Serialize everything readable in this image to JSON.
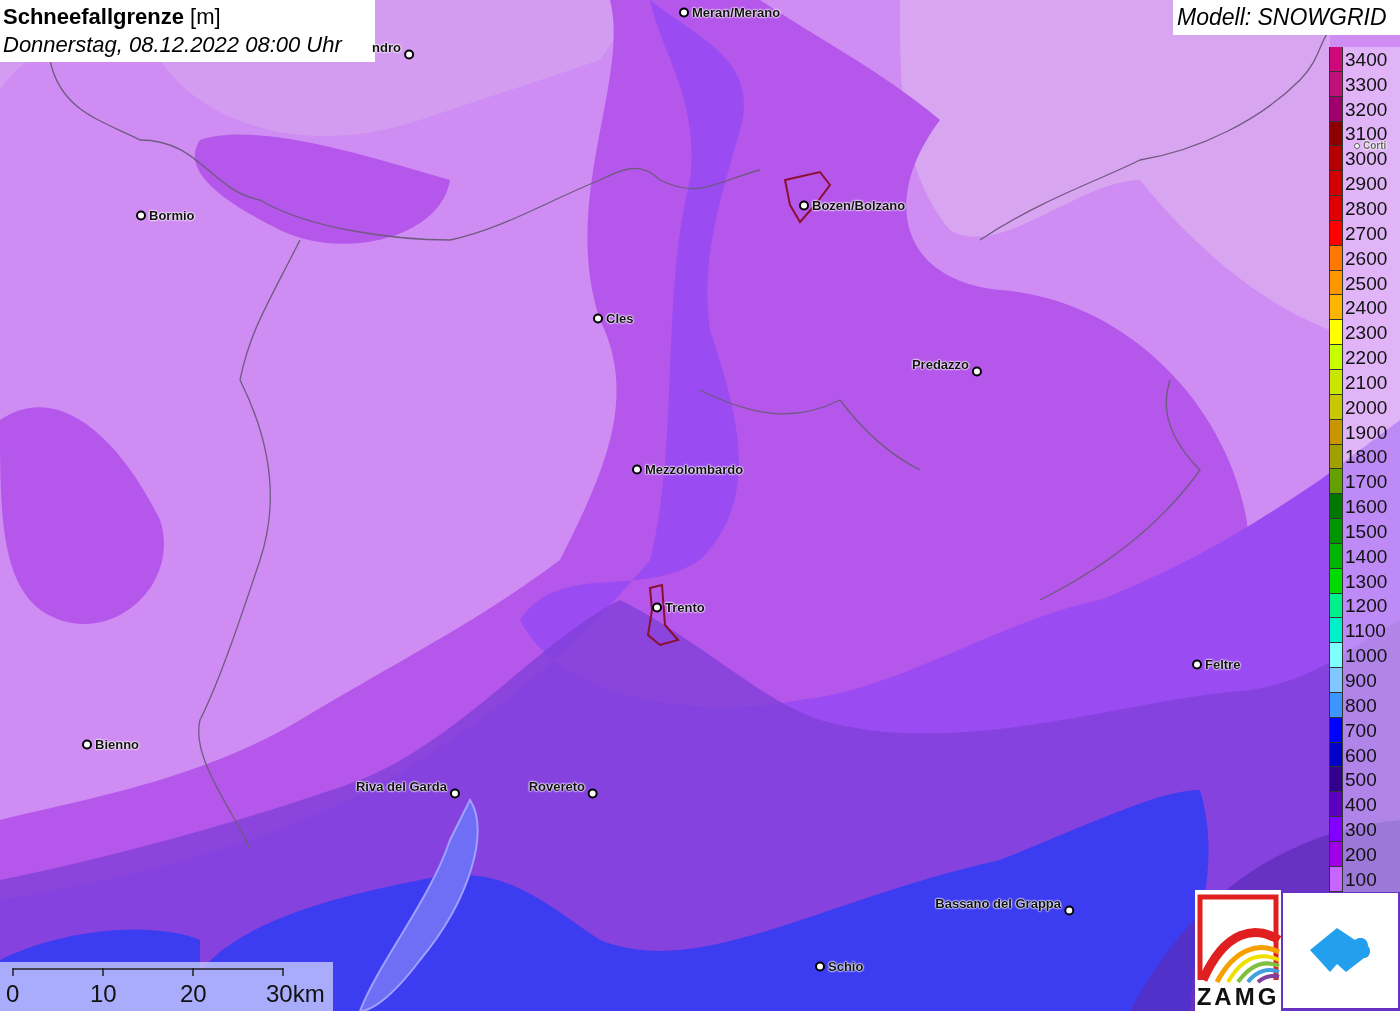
{
  "title": {
    "name": "Schneefallgrenze",
    "unit": "[m]",
    "time": "Donnerstag, 08.12.2022 08:00 Uhr"
  },
  "model": "Modell: SNOWGRID",
  "places": [
    {
      "name": "Meran/Merano"
    },
    {
      "name": "ndro"
    },
    {
      "name": "Bormio"
    },
    {
      "name": "Bozen/Bolzano"
    },
    {
      "name": "Corti"
    },
    {
      "name": "Cles"
    },
    {
      "name": "Predazzo"
    },
    {
      "name": "Mezzolombardo"
    },
    {
      "name": "Trento"
    },
    {
      "name": "Feltre"
    },
    {
      "name": "Bienno"
    },
    {
      "name": "Riva del Garda"
    },
    {
      "name": "Rovereto"
    },
    {
      "name": "Bassano del Grappa"
    },
    {
      "name": "Schio"
    }
  ],
  "legend": [
    {
      "label": "3400",
      "color": "#d0087a"
    },
    {
      "label": "3300",
      "color": "#c0107a"
    },
    {
      "label": "3200",
      "color": "#a0006e"
    },
    {
      "label": "3100",
      "color": "#8c0000"
    },
    {
      "label": "3000",
      "color": "#b40000"
    },
    {
      "label": "2900",
      "color": "#d20000"
    },
    {
      "label": "2800",
      "color": "#e00000"
    },
    {
      "label": "2700",
      "color": "#ff0000"
    },
    {
      "label": "2600",
      "color": "#ff7800"
    },
    {
      "label": "2500",
      "color": "#ff9600"
    },
    {
      "label": "2400",
      "color": "#ffb400"
    },
    {
      "label": "2300",
      "color": "#ffff00"
    },
    {
      "label": "2200",
      "color": "#c8ff00"
    },
    {
      "label": "2100",
      "color": "#c8e600"
    },
    {
      "label": "2000",
      "color": "#c8c800"
    },
    {
      "label": "1900",
      "color": "#c89600"
    },
    {
      "label": "1800",
      "color": "#a0a000"
    },
    {
      "label": "1700",
      "color": "#64a000"
    },
    {
      "label": "1600",
      "color": "#007800"
    },
    {
      "label": "1500",
      "color": "#009600"
    },
    {
      "label": "1400",
      "color": "#00b400"
    },
    {
      "label": "1300",
      "color": "#00dc00"
    },
    {
      "label": "1200",
      "color": "#00f08c"
    },
    {
      "label": "1100",
      "color": "#00f0c8"
    },
    {
      "label": "1000",
      "color": "#80ffff"
    },
    {
      "label": "900",
      "color": "#80c8ff"
    },
    {
      "label": "800",
      "color": "#3c96ff"
    },
    {
      "label": "700",
      "color": "#0000ff"
    },
    {
      "label": "600",
      "color": "#0000c8"
    },
    {
      "label": "500",
      "color": "#32008c"
    },
    {
      "label": "400",
      "color": "#5a00be"
    },
    {
      "label": "300",
      "color": "#8200ff"
    },
    {
      "label": "200",
      "color": "#a000e6"
    },
    {
      "label": "100",
      "color": "#c864ff"
    }
  ],
  "scale": {
    "ticks": [
      "0",
      "10",
      "20",
      "30km"
    ]
  },
  "logo": {
    "text": "ZAMG"
  }
}
